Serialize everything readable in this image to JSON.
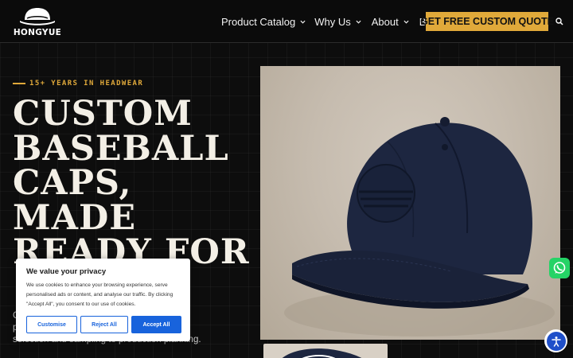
{
  "header": {
    "logo_text": "HONGYUE",
    "nav": [
      {
        "label": "Product Catalog",
        "has_dropdown": true
      },
      {
        "label": "Why Us",
        "has_dropdown": true
      },
      {
        "label": "About",
        "has_dropdown": true
      },
      {
        "label": "Blog",
        "has_dropdown": false
      }
    ],
    "cta_label": "GET FREE CUSTOM QUOTE",
    "search_icon": "search-icon"
  },
  "hero": {
    "eyebrow": "15+ YEARS IN HEADWEAR",
    "title_lines": [
      "CUSTOM",
      "BASEBALL",
      "CAPS,",
      "MADE",
      "READY FOR"
    ],
    "description_visible": [
      "C                                          , importers,",
      "p                                          material",
      "selection and sampling to production planning."
    ]
  },
  "cookie_banner": {
    "title": "We value your privacy",
    "text": "We use cookies to enhance your browsing experience, serve personalised ads or content, and analyse our traffic. By clicking \"Accept All\", you consent to our use of cookies.",
    "customise_label": "Customise",
    "reject_label": "Reject All",
    "accept_label": "Accept All"
  },
  "floating": {
    "whatsapp_icon": "whatsapp-icon",
    "accessibility_icon": "accessibility-icon"
  },
  "colors": {
    "accent": "#e0a93a",
    "background": "#0d0d0d",
    "cookie_blue": "#1863dc",
    "whatsapp": "#25d366"
  }
}
